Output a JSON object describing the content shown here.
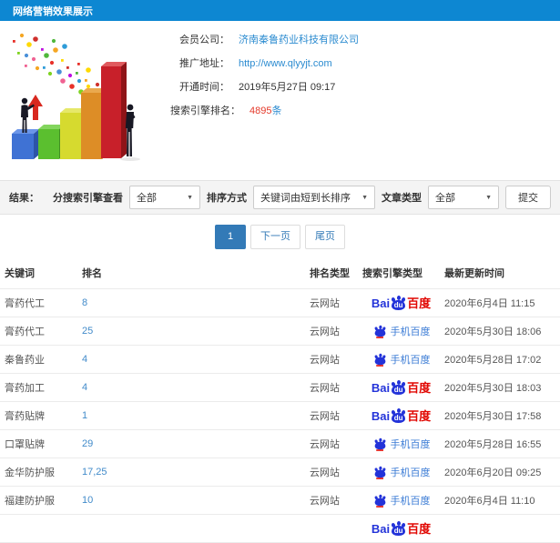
{
  "header": {
    "title": "网络营销效果展示"
  },
  "info": {
    "company_label": "会员公司：",
    "company_value": "济南秦鲁药业科技有限公司",
    "url_label": "推广地址：",
    "url_value": "http://www.qlyyjt.com",
    "opened_label": "开通时间：",
    "opened_value": "2019年5月27日 09:17",
    "rank_label": "搜索引擎排名：",
    "rank_value": "4895",
    "rank_unit": "条"
  },
  "filters": {
    "result_label": "结果：",
    "engine_label": "分搜索引擎查看",
    "engine_value": "全部",
    "sort_label": "排序方式",
    "sort_value": "关键词由短到长排序",
    "article_label": "文章类型",
    "article_value": "全部",
    "submit_label": "提交",
    "caret": "▼"
  },
  "pagination": {
    "current": "1",
    "next_label": "下一页",
    "last_label": "尾页"
  },
  "table": {
    "headers": [
      "关键词",
      "排名",
      "排名类型",
      "搜索引擎类型",
      "最新更新时间"
    ],
    "rows": [
      {
        "keyword": "膏药代工",
        "rank": "8",
        "rank_type": "云网站",
        "engine": "baidu",
        "time": "2020年6月4日 11:15"
      },
      {
        "keyword": "膏药代工",
        "rank": "25",
        "rank_type": "云网站",
        "engine": "mobile",
        "time": "2020年5月30日 18:06"
      },
      {
        "keyword": "秦鲁药业",
        "rank": "4",
        "rank_type": "云网站",
        "engine": "mobile",
        "time": "2020年5月28日 17:02"
      },
      {
        "keyword": "膏药加工",
        "rank": "4",
        "rank_type": "云网站",
        "engine": "baidu",
        "time": "2020年5月30日 18:03"
      },
      {
        "keyword": "膏药贴牌",
        "rank": "1",
        "rank_type": "云网站",
        "engine": "baidu",
        "time": "2020年5月30日 17:58"
      },
      {
        "keyword": "口罩贴牌",
        "rank": "29",
        "rank_type": "云网站",
        "engine": "mobile",
        "time": "2020年5月28日 16:55"
      },
      {
        "keyword": "金华防护服",
        "rank": "17,25",
        "rank_type": "云网站",
        "engine": "mobile",
        "time": "2020年6月20日 09:25"
      },
      {
        "keyword": "福建防护服",
        "rank": "10",
        "rank_type": "云网站",
        "engine": "mobile",
        "time": "2020年6月4日 11:10"
      }
    ],
    "partial_row": {
      "engine": "baidu"
    }
  },
  "logos": {
    "baidu_bai": "Bai",
    "baidu_du": "du",
    "baidu_cn": "百度",
    "mobile_label": "手机百度"
  },
  "colors": {
    "header_bg": "#0d87d2",
    "link_blue": "#2b8bd0",
    "rank_count_red": "#e4392a",
    "rank_link_blue": "#428bca",
    "active_page_blue": "#337ab7",
    "baidu_blue": "#2333d9",
    "baidu_red": "#e10601"
  }
}
